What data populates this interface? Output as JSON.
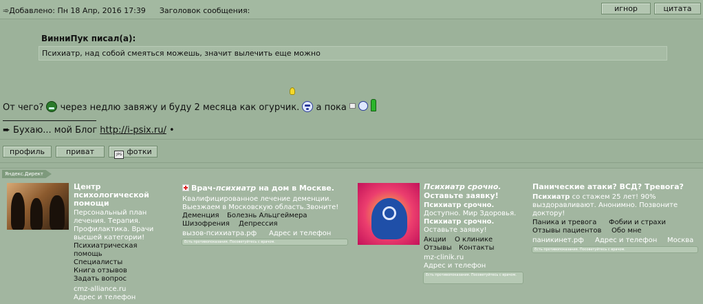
{
  "post": {
    "meta": "Добавлено: Пн 18 Апр, 2016 17:39",
    "subject_label": "Заголовок сообщения:",
    "ignore_button": "игнор",
    "quote_button": "цитата"
  },
  "quote": {
    "author": "ВинниПук писал(а):",
    "text": "Психиатр, над собой смеяться можешь, значит вылечить еще можно"
  },
  "message": {
    "part1": "От чего?",
    "part2": "через недлю завяжу и буду 2 месяца как огурчик.",
    "part3": "а пока"
  },
  "signature": {
    "prefix": "Бухаю... мой Блог",
    "link": "http://i-psix.ru/",
    "suffix": "•"
  },
  "buttons": {
    "profile": "профиль",
    "private": "приват",
    "photos": "фотки"
  },
  "ads": {
    "tag": "Яндекс.Директ",
    "ad1": {
      "title": "Центр психологической помощи",
      "text": "Персональный план лечения. Терапия. Профилактика. Врачи высшей категории!",
      "links": [
        "Психиатрическая помощь",
        "Специалисты",
        "Книга отзывов",
        "Задать вопрос"
      ],
      "domain": "cmz-alliance.ru",
      "contacts": "Адрес и телефон"
    },
    "ad2": {
      "title_a": "Врач-",
      "title_b": "психиатр",
      "title_c": " на дом в Москве.",
      "text": "Квалифицированное лечение деменции. Выезжаем в Московскую область.Звоните!",
      "links": [
        "Деменция",
        "Болезнь Альцгеймера",
        "Шизофрения",
        "Депрессия"
      ],
      "domain": "вызов-психиатра.рф",
      "contacts": "Адрес и телефон",
      "note": "Есть противопоказания. Посоветуйтесь с врачом."
    },
    "ad3": {
      "title_a": "Психиатр срочно.",
      "title_b": "Оставьте заявку!",
      "line1_bold": "Психиатр срочно.",
      "line2": "Доступно. Мир Здоровья.",
      "line3_bold": "Психиатр срочно.",
      "line4": "Оставьте заявку!",
      "links": [
        "Акции",
        "О клинике",
        "Отзывы",
        "Контакты"
      ],
      "domain": "mz-clinik.ru",
      "contacts": "Адрес и телефон",
      "note": "Есть противопоказания. Посоветуйтесь с врачом."
    },
    "ad4": {
      "title": "Панические атаки? ВСД? Тревога?",
      "text_bold": "Психиатр",
      "text": " со стажем 25 лет! 90% выздоравливают. Анонимно. Позвоните доктору!",
      "links": [
        "Паника и тревога",
        "Фобии и страхи",
        "Отзывы пациентов",
        "Обо мне"
      ],
      "domain": "паникинет.рф",
      "contacts": "Адрес и телефон",
      "city": "Москва",
      "note": "Есть противопоказания. Посоветуйтесь с врачом."
    }
  }
}
